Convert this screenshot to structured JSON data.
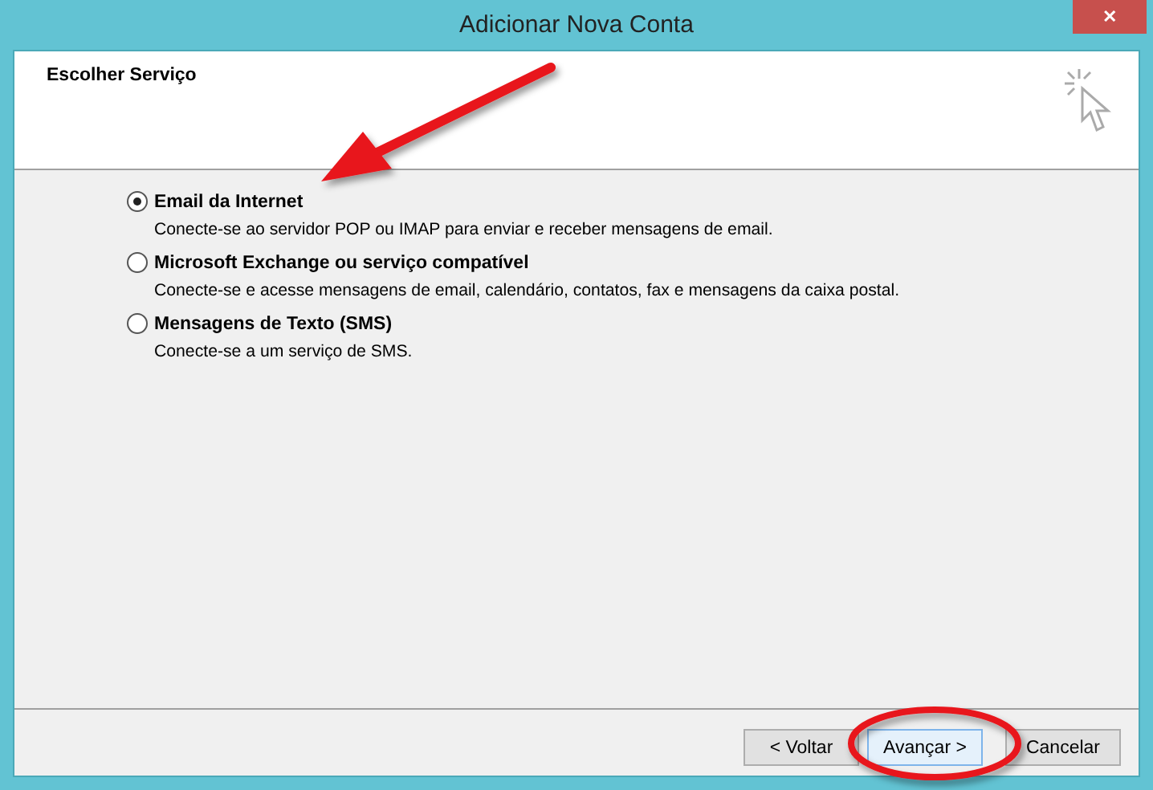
{
  "window": {
    "title": "Adicionar Nova Conta",
    "close": "✕"
  },
  "header": {
    "title": "Escolher Serviço"
  },
  "options": [
    {
      "label": "Email da Internet",
      "description": "Conecte-se ao servidor POP ou IMAP para enviar e receber mensagens de email.",
      "selected": true
    },
    {
      "label": "Microsoft Exchange ou serviço compatível",
      "description": "Conecte-se e acesse mensagens de email, calendário, contatos, fax e mensagens da caixa postal.",
      "selected": false
    },
    {
      "label": "Mensagens de Texto (SMS)",
      "description": "Conecte-se a um serviço de SMS.",
      "selected": false
    }
  ],
  "buttons": [
    {
      "label": "< Voltar",
      "default": false
    },
    {
      "label": "Avançar >",
      "default": true
    },
    {
      "label": "Cancelar",
      "default": false
    }
  ]
}
